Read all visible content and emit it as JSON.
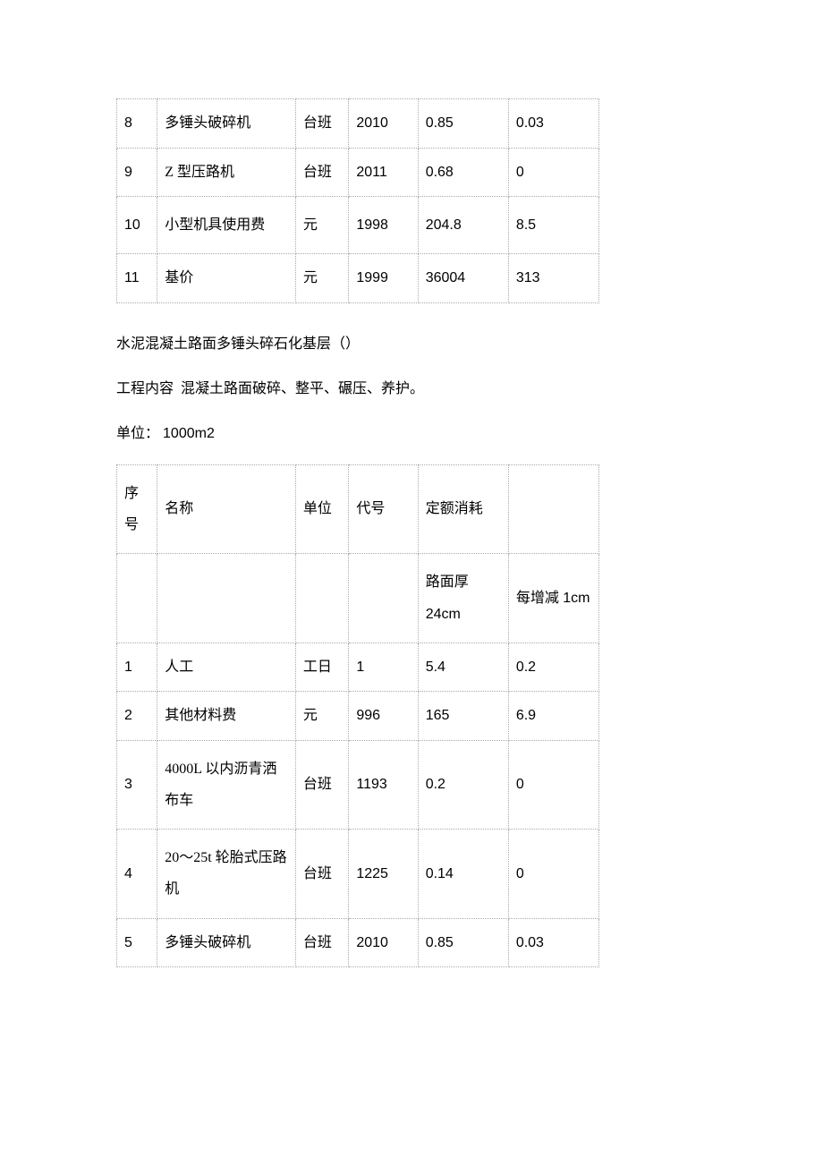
{
  "table1": {
    "rows": [
      {
        "seq": "8",
        "name": "多锤头破碎机",
        "unit": "台班",
        "code": "2010",
        "v1": "0.85",
        "v2": "0.03"
      },
      {
        "seq": "9",
        "name": "Z 型压路机",
        "unit": "台班",
        "code": "2011",
        "v1": "0.68",
        "v2": "0"
      },
      {
        "seq": "10",
        "name": "小型机具使用费",
        "unit": "元",
        "code": "1998",
        "v1": "204.8",
        "v2": "8.5"
      },
      {
        "seq": "11",
        "name": "基价",
        "unit": "元",
        "code": "1999",
        "v1": "36004",
        "v2": "313"
      }
    ]
  },
  "section": {
    "title": "水泥混凝土路面多锤头碎石化基层（）",
    "content_label": "工程内容",
    "content_text": "混凝土路面破碎、整平、碾压、养护。",
    "unit_label": "单位：",
    "unit_text": "1000m2"
  },
  "table2": {
    "header": {
      "seq": "序号",
      "name": "名称",
      "unit": "单位",
      "code": "代号",
      "quota": "定额消耗"
    },
    "subheader": {
      "v1": "路面厚 24cm",
      "v2": "每增减 1cm"
    },
    "rows": [
      {
        "seq": "1",
        "name": "人工",
        "unit": "工日",
        "code": "1",
        "v1": "5.4",
        "v2": "0.2"
      },
      {
        "seq": "2",
        "name": "其他材料费",
        "unit": "元",
        "code": "996",
        "v1": "165",
        "v2": "6.9"
      },
      {
        "seq": "3",
        "name": "4000L 以内沥青洒布车",
        "unit": "台班",
        "code": "1193",
        "v1": "0.2",
        "v2": "0"
      },
      {
        "seq": "4",
        "name": "20～25t 轮胎式压路机",
        "unit": "台班",
        "code": "1225",
        "v1": "0.14",
        "v2": "0"
      },
      {
        "seq": "5",
        "name": "多锤头破碎机",
        "unit": "台班",
        "code": "2010",
        "v1": "0.85",
        "v2": "0.03"
      }
    ]
  }
}
